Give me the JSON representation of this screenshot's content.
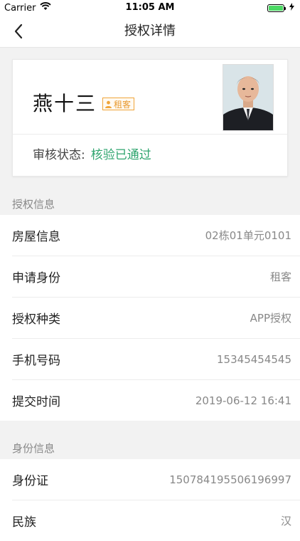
{
  "status_bar": {
    "carrier": "Carrier",
    "time": "11:05 AM"
  },
  "nav": {
    "title": "授权详情"
  },
  "profile": {
    "name": "燕十三",
    "role_tag": "租客",
    "status_label": "审核状态:",
    "status_value": "核验已通过",
    "status_color": "#2fa56f",
    "tag_color": "#f0a53a"
  },
  "auth_section": {
    "title": "授权信息",
    "rows": [
      {
        "label": "房屋信息",
        "value": "02栋01单元0101"
      },
      {
        "label": "申请身份",
        "value": "租客"
      },
      {
        "label": "授权种类",
        "value": "APP授权"
      },
      {
        "label": "手机号码",
        "value": "15345454545"
      },
      {
        "label": "提交时间",
        "value": "2019-06-12 16:41"
      }
    ]
  },
  "id_section": {
    "title": "身份信息",
    "rows": [
      {
        "label": "身份证",
        "value": "150784195506196997"
      },
      {
        "label": "民族",
        "value": "汉"
      }
    ]
  }
}
